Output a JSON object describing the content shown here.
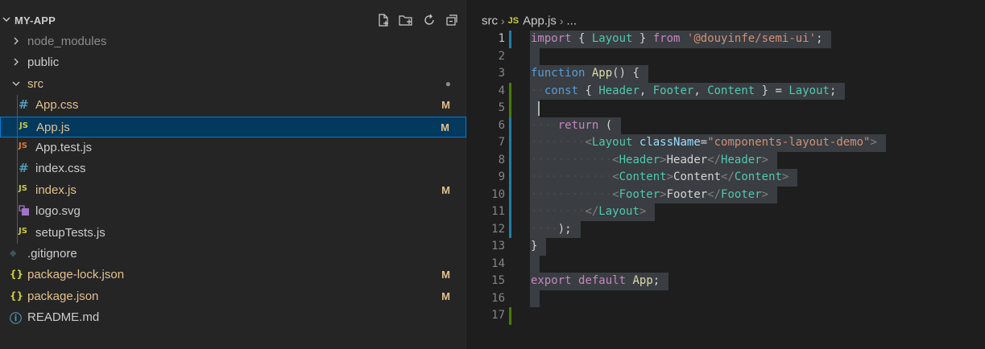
{
  "explorer": {
    "title": "MY-APP",
    "actions": [
      "new-file-icon",
      "new-folder-icon",
      "refresh-icon",
      "collapse-all-icon"
    ],
    "items": [
      {
        "label": "node_modules",
        "kind": "folder",
        "expanded": false,
        "depth": 0,
        "color": "#8c8c8c",
        "badge": ""
      },
      {
        "label": "public",
        "kind": "folder",
        "expanded": false,
        "depth": 0,
        "color": "#cccccc",
        "badge": ""
      },
      {
        "label": "src",
        "kind": "folder",
        "expanded": true,
        "depth": 0,
        "color": "#e2c08d",
        "badge": "●"
      },
      {
        "label": "App.css",
        "kind": "css",
        "depth": 1,
        "color": "#e2c08d",
        "badge": "M"
      },
      {
        "label": "App.js",
        "kind": "js",
        "depth": 1,
        "color": "#e2c08d",
        "badge": "M",
        "selected": true
      },
      {
        "label": "App.test.js",
        "kind": "test",
        "depth": 1,
        "color": "#cccccc",
        "badge": ""
      },
      {
        "label": "index.css",
        "kind": "css",
        "depth": 1,
        "color": "#cccccc",
        "badge": ""
      },
      {
        "label": "index.js",
        "kind": "js",
        "depth": 1,
        "color": "#e2c08d",
        "badge": "M"
      },
      {
        "label": "logo.svg",
        "kind": "svg",
        "depth": 1,
        "color": "#cccccc",
        "badge": ""
      },
      {
        "label": "setupTests.js",
        "kind": "js",
        "depth": 1,
        "color": "#cccccc",
        "badge": ""
      },
      {
        "label": ".gitignore",
        "kind": "git",
        "depth": 0,
        "color": "#cccccc",
        "badge": ""
      },
      {
        "label": "package-lock.json",
        "kind": "json",
        "depth": 0,
        "color": "#e2c08d",
        "badge": "M"
      },
      {
        "label": "package.json",
        "kind": "json",
        "depth": 0,
        "color": "#e2c08d",
        "badge": "M"
      },
      {
        "label": "README.md",
        "kind": "info",
        "depth": 0,
        "color": "#cccccc",
        "badge": ""
      }
    ]
  },
  "breadcrumb": {
    "folder": "src",
    "file_tag": "JS",
    "file": "App.js",
    "more": "..."
  },
  "editor": {
    "current_line": 1,
    "lines": [
      {
        "n": "1",
        "gutter": "mod",
        "tokens": [
          [
            "kw",
            "import"
          ],
          [
            "p",
            " { "
          ],
          [
            "id",
            "Layout"
          ],
          [
            "p",
            " } "
          ],
          [
            "kw",
            "from"
          ],
          [
            "p",
            " "
          ],
          [
            "s",
            "'@douyinfe/semi-ui'"
          ],
          [
            "p",
            ";"
          ]
        ]
      },
      {
        "n": "2",
        "gutter": "",
        "tokens": []
      },
      {
        "n": "3",
        "gutter": "",
        "tokens": [
          [
            "kb",
            "function"
          ],
          [
            "p",
            " "
          ],
          [
            "fn",
            "App"
          ],
          [
            "p",
            "() {"
          ]
        ]
      },
      {
        "n": "4",
        "gutter": "add",
        "tokens": [
          [
            "ws",
            "··"
          ],
          [
            "kb",
            "const"
          ],
          [
            "p",
            " { "
          ],
          [
            "id",
            "Header"
          ],
          [
            "p",
            ", "
          ],
          [
            "id",
            "Footer"
          ],
          [
            "p",
            ", "
          ],
          [
            "id",
            "Content"
          ],
          [
            "p",
            " } = "
          ],
          [
            "id",
            "Layout"
          ],
          [
            "p",
            ";"
          ]
        ]
      },
      {
        "n": "5",
        "gutter": "add",
        "tokens": []
      },
      {
        "n": "6",
        "gutter": "mod",
        "tokens": [
          [
            "ws",
            "····"
          ],
          [
            "kw",
            "return"
          ],
          [
            "p",
            " ("
          ]
        ]
      },
      {
        "n": "7",
        "gutter": "mod",
        "tokens": [
          [
            "ws",
            "········"
          ],
          [
            "tg",
            "<"
          ],
          [
            "id",
            "Layout"
          ],
          [
            "p",
            " "
          ],
          [
            "v",
            "className"
          ],
          [
            "p",
            "="
          ],
          [
            "s",
            "\"components-layout-demo\""
          ],
          [
            "tg",
            ">"
          ]
        ]
      },
      {
        "n": "8",
        "gutter": "mod",
        "tokens": [
          [
            "ws",
            "············"
          ],
          [
            "tg",
            "<"
          ],
          [
            "id",
            "Header"
          ],
          [
            "tg",
            ">"
          ],
          [
            "p",
            "Header"
          ],
          [
            "tg",
            "</"
          ],
          [
            "id",
            "Header"
          ],
          [
            "tg",
            ">"
          ]
        ]
      },
      {
        "n": "9",
        "gutter": "mod",
        "tokens": [
          [
            "ws",
            "············"
          ],
          [
            "tg",
            "<"
          ],
          [
            "id",
            "Content"
          ],
          [
            "tg",
            ">"
          ],
          [
            "p",
            "Content"
          ],
          [
            "tg",
            "</"
          ],
          [
            "id",
            "Content"
          ],
          [
            "tg",
            ">"
          ]
        ]
      },
      {
        "n": "10",
        "gutter": "mod",
        "tokens": [
          [
            "ws",
            "············"
          ],
          [
            "tg",
            "<"
          ],
          [
            "id",
            "Footer"
          ],
          [
            "tg",
            ">"
          ],
          [
            "p",
            "Footer"
          ],
          [
            "tg",
            "</"
          ],
          [
            "id",
            "Footer"
          ],
          [
            "tg",
            ">"
          ]
        ]
      },
      {
        "n": "11",
        "gutter": "mod",
        "tokens": [
          [
            "ws",
            "········"
          ],
          [
            "tg",
            "</"
          ],
          [
            "id",
            "Layout"
          ],
          [
            "tg",
            ">"
          ]
        ]
      },
      {
        "n": "12",
        "gutter": "mod",
        "tokens": [
          [
            "ws",
            "····"
          ],
          [
            "p",
            ");"
          ]
        ]
      },
      {
        "n": "13",
        "gutter": "",
        "tokens": [
          [
            "p",
            "}"
          ]
        ]
      },
      {
        "n": "14",
        "gutter": "",
        "tokens": []
      },
      {
        "n": "15",
        "gutter": "",
        "tokens": [
          [
            "kw",
            "export"
          ],
          [
            "p",
            " "
          ],
          [
            "kw",
            "default"
          ],
          [
            "p",
            " "
          ],
          [
            "fn",
            "App"
          ],
          [
            "p",
            ";"
          ]
        ]
      },
      {
        "n": "16",
        "gutter": "",
        "tokens": []
      },
      {
        "n": "17",
        "gutter": "add",
        "tokens": []
      }
    ]
  }
}
